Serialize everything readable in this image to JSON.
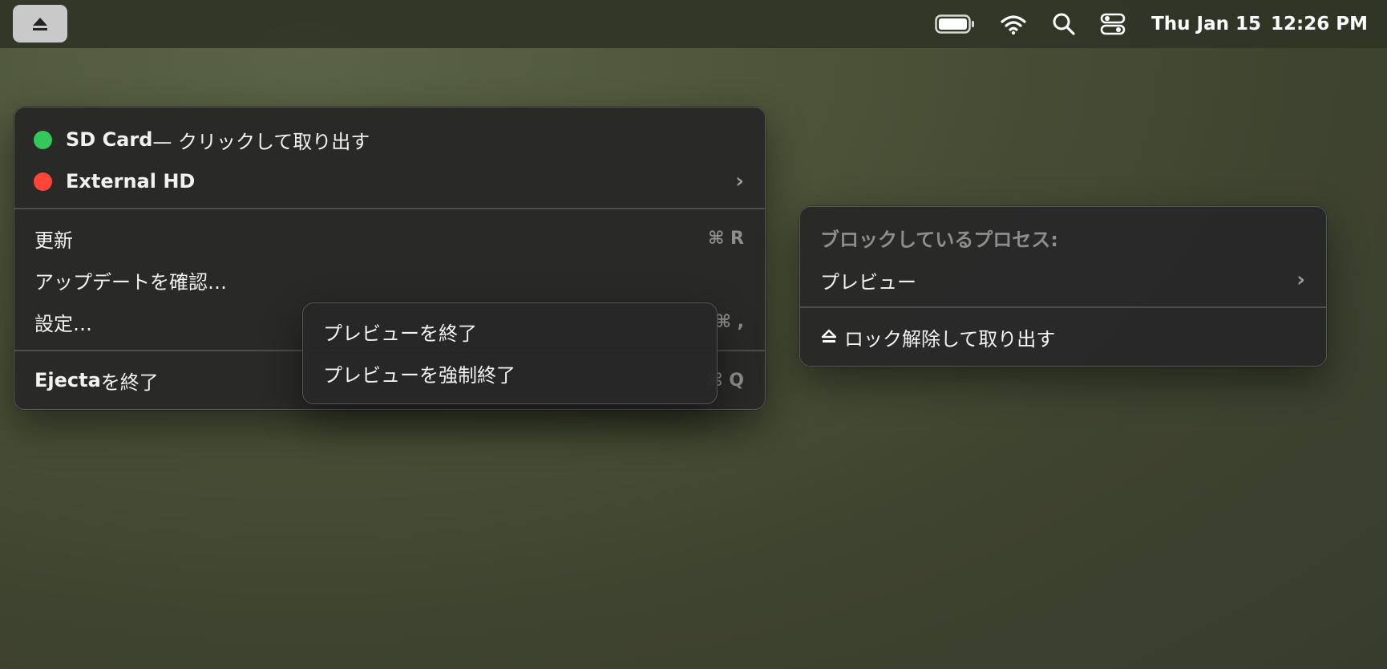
{
  "menubar": {
    "clock_day": "Thu Jan 15",
    "clock_time": "12:26 PM",
    "icons": [
      "eject-icon",
      "battery-icon",
      "wifi-icon",
      "search-icon",
      "control-center-icon"
    ]
  },
  "main_menu": {
    "drives": [
      {
        "name": "SD Card",
        "suffix": " — クリックして取り出す",
        "status_color": "#34c759"
      },
      {
        "name": "External HD",
        "suffix": "",
        "status_color": "#ff453a",
        "has_submenu": true
      }
    ],
    "refresh_label": "更新",
    "refresh_shortcut": "⌘ R",
    "check_updates_label": "アップデートを確認…",
    "settings_label": "設定…",
    "settings_shortcut": "⌘ ,",
    "quit_label_app": "Ejecta",
    "quit_label_suffix": "を終了",
    "quit_shortcut": "⌘ Q"
  },
  "process_submenu": {
    "quit_label": "プレビューを終了",
    "force_quit_label": "プレビューを強制終了"
  },
  "blocking_menu": {
    "header": "ブロックしているプロセス:",
    "process_label": "プレビュー",
    "unlock_eject_label": "ロック解除して取り出す"
  }
}
